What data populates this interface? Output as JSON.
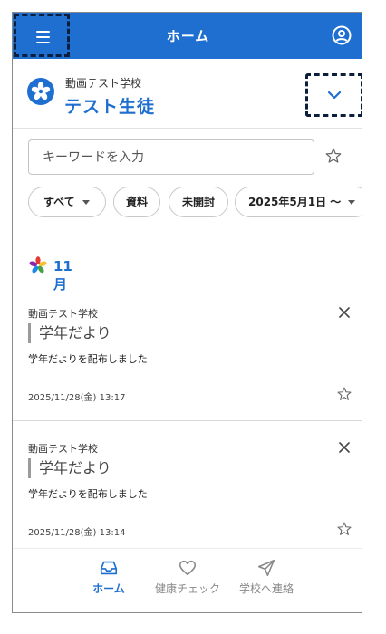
{
  "header": {
    "title": "ホーム"
  },
  "student": {
    "school_name": "動画テスト学校",
    "student_name": "テスト生徒"
  },
  "search": {
    "placeholder": "キーワードを入力"
  },
  "filters": [
    {
      "label": "すべて",
      "dropdown": true
    },
    {
      "label": "資料",
      "dropdown": false
    },
    {
      "label": "未開封",
      "dropdown": false
    },
    {
      "label": "2025年5月1日 ～",
      "dropdown": true
    }
  ],
  "month_label": "11月",
  "notices": [
    {
      "school": "動画テスト学校",
      "title": "学年だより",
      "body": "学年だよりを配布しました",
      "date": "2025/11/28(金) 13:17"
    },
    {
      "school": "動画テスト学校",
      "title": "学年だより",
      "body": "学年だよりを配布しました",
      "date": "2025/11/28(金) 13:14"
    }
  ],
  "bottom_nav": [
    {
      "label": "ホーム",
      "icon": "inbox-icon",
      "active": true
    },
    {
      "label": "健康チェック",
      "icon": "heart-icon",
      "active": false
    },
    {
      "label": "学校へ連絡",
      "icon": "send-icon",
      "active": false
    }
  ],
  "colors": {
    "accent": "#1f6fd0",
    "header_bg": "#1f6fd0",
    "highlight_border": "#0b1f3c"
  }
}
